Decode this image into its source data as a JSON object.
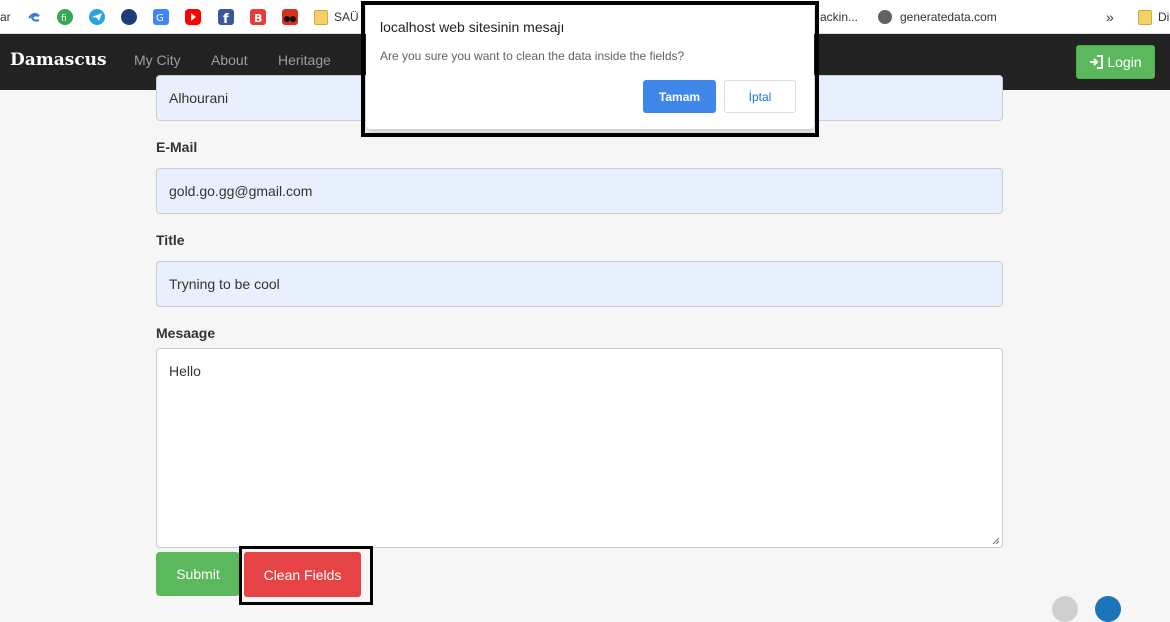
{
  "bookmarks": {
    "left_partial": "ar",
    "sau_label": "SAÜ",
    "tracking_partial": "ackin...",
    "generatedata_label": "generatedata.com",
    "overflow": "»",
    "right_partial": "Di"
  },
  "navbar": {
    "brand": "Damascus",
    "links": [
      "My City",
      "About",
      "Heritage"
    ],
    "login_label": "Login"
  },
  "form": {
    "surname_value": "Alhourani",
    "email_label": "E-Mail",
    "email_value": "gold.go.gg@gmail.com",
    "title_label": "Title",
    "title_value": "Tryning to be cool",
    "message_label": "Mesaage",
    "message_value": "Hello",
    "submit_label": "Submit",
    "clean_label": "Clean Fields"
  },
  "dialog": {
    "title": "localhost web sitesinin mesajı",
    "message": "Are you sure you want to clean the data inside the fields?",
    "ok_label": "Tamam",
    "cancel_label": "İptal"
  },
  "colors": {
    "navbar_bg": "#222222",
    "success": "#5cb85c",
    "danger": "#e54345",
    "dialog_ok": "#3f87e9",
    "autofill": "#e8f0fe"
  }
}
